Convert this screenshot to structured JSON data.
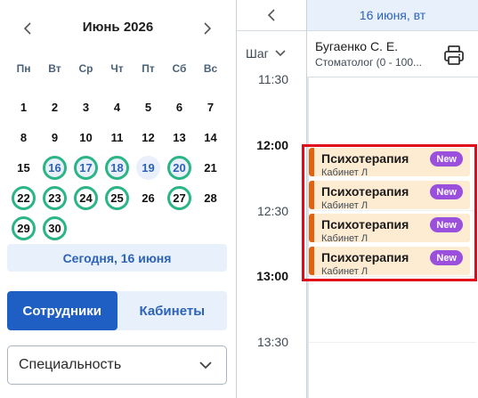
{
  "calendar": {
    "month_title": "Июнь 2026",
    "weekdays": [
      "Пн",
      "Вт",
      "Ср",
      "Чт",
      "Пт",
      "Сб",
      "Вс"
    ],
    "weeks": [
      [
        {
          "d": "1"
        },
        {
          "d": "2"
        },
        {
          "d": "3"
        },
        {
          "d": "4"
        },
        {
          "d": "5"
        },
        {
          "d": "6"
        },
        {
          "d": "7"
        }
      ],
      [
        {
          "d": "8"
        },
        {
          "d": "9"
        },
        {
          "d": "10"
        },
        {
          "d": "11"
        },
        {
          "d": "12"
        },
        {
          "d": "13"
        },
        {
          "d": "14"
        }
      ],
      [
        {
          "d": "15"
        },
        {
          "d": "16",
          "s": "hl-sel"
        },
        {
          "d": "17",
          "s": "hl-sel"
        },
        {
          "d": "18",
          "s": "hl-sel"
        },
        {
          "d": "19",
          "s": "fill"
        },
        {
          "d": "20",
          "s": "hl-sel"
        },
        {
          "d": "21"
        }
      ],
      [
        {
          "d": "22",
          "s": "hl"
        },
        {
          "d": "23",
          "s": "hl"
        },
        {
          "d": "24",
          "s": "hl"
        },
        {
          "d": "25",
          "s": "hl"
        },
        {
          "d": "26"
        },
        {
          "d": "27",
          "s": "hl"
        },
        {
          "d": "28"
        }
      ],
      [
        {
          "d": "29",
          "s": "hl"
        },
        {
          "d": "30",
          "s": "hl"
        },
        {
          "d": ""
        },
        {
          "d": ""
        },
        {
          "d": ""
        },
        {
          "d": ""
        },
        {
          "d": ""
        }
      ]
    ],
    "today_label": "Сегодня, 16 июня"
  },
  "toggle": {
    "staff_label": "Сотрудники",
    "rooms_label": "Кабинеты"
  },
  "filter": {
    "specialty_label": "Специальность"
  },
  "schedule": {
    "step_label": "Шаг",
    "date_header": "16 июня, вт",
    "times": [
      "11:30",
      "12:00",
      "12:30",
      "13:00",
      "13:30"
    ],
    "doctor": {
      "name": "Бугаенко С. Е.",
      "specialty": "Стоматолог (0 - 100..."
    },
    "appointments": [
      {
        "title": "Психотерапия",
        "room": "Кабинет Л",
        "badge": "New"
      },
      {
        "title": "Психотерапия",
        "room": "Кабинет Л",
        "badge": "New"
      },
      {
        "title": "Психотерапия",
        "room": "Кабинет Л",
        "badge": "New"
      },
      {
        "title": "Психотерапия",
        "room": "Кабинет Л",
        "badge": "New"
      }
    ]
  },
  "icons": {
    "prev_month": "chevron-left-icon",
    "next_month": "chevron-right-icon",
    "prev_day": "chevron-left-icon",
    "step_dropdown": "chevron-down-icon",
    "specialty_dropdown": "chevron-down-icon",
    "print": "printer-icon"
  },
  "colors": {
    "accent": "#1f5fc4",
    "accent_light": "#e8f0fb",
    "available_ring": "#2bb585",
    "appointment_bg": "#fdebd2",
    "appointment_bar": "#e2620f",
    "badge_new": "#9b4fdd",
    "selection": "#e00a1a"
  }
}
